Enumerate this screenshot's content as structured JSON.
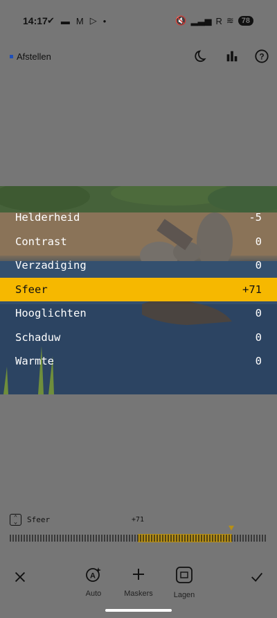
{
  "status_bar": {
    "time": "14:17",
    "signal_label": "R",
    "battery": "78"
  },
  "header": {
    "title": "Afstellen"
  },
  "adjustments": [
    {
      "name": "Helderheid",
      "value": "-5"
    },
    {
      "name": "Contrast",
      "value": "0"
    },
    {
      "name": "Verzadiging",
      "value": "0"
    },
    {
      "name": "Sfeer",
      "value": "+71",
      "selected": true
    },
    {
      "name": "Hooglichten",
      "value": "0"
    },
    {
      "name": "Schaduw",
      "value": "0"
    },
    {
      "name": "Warmte",
      "value": "0"
    }
  ],
  "slider": {
    "label": "Sfeer",
    "value_text": "+71",
    "value": 71,
    "min": -100,
    "max": 100
  },
  "toolbar": {
    "auto_label": "Auto",
    "masks_label": "Maskers",
    "layers_label": "Lagen"
  },
  "colors": {
    "accent": "#f6b800",
    "slider_fill": "#b68f17",
    "background": "#767676"
  }
}
